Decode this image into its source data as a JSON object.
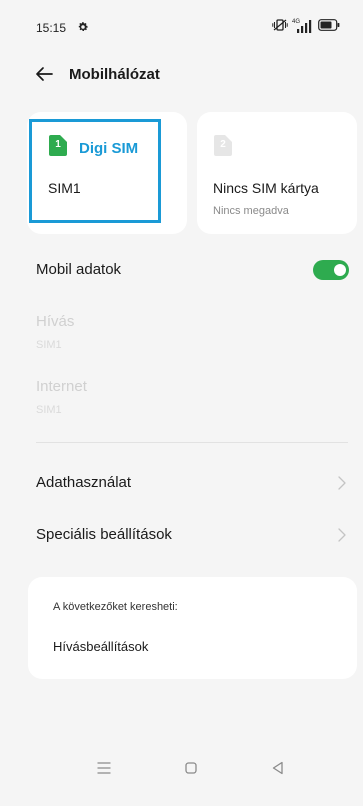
{
  "status_bar": {
    "time": "15:15",
    "icons": [
      "gear-icon",
      "vibrate-icon",
      "network-4g-icon",
      "signal-icon",
      "battery-icon"
    ],
    "network_label": "4G"
  },
  "header": {
    "title": "Mobilhálózat",
    "back_icon": "arrow-left-icon"
  },
  "sim_cards": [
    {
      "slot_number": "1",
      "carrier": "Digi SIM",
      "label": "SIM1",
      "icon_color": "#2eab4f",
      "highlighted": true
    },
    {
      "slot_number": "2",
      "title": "Nincs SIM kártya",
      "subtitle": "Nincs megadva",
      "icon_color": "#e6e6e6"
    }
  ],
  "settings": {
    "mobile_data": {
      "label": "Mobil adatok",
      "enabled": true
    },
    "calls": {
      "label": "Hívás",
      "sub": "SIM1",
      "disabled": true
    },
    "internet": {
      "label": "Internet",
      "sub": "SIM1",
      "disabled": true
    },
    "data_usage": {
      "label": "Adathasználat"
    },
    "special_settings": {
      "label": "Speciális beállítások"
    }
  },
  "suggestions": {
    "heading": "A következőket keresheti:",
    "items": [
      "Hívásbeállítások"
    ]
  },
  "colors": {
    "accent": "#1a9ad6",
    "toggle_on": "#2eab4f",
    "background": "#f5f5f5"
  },
  "nav_bar": {
    "icons": [
      "menu-icon",
      "home-icon",
      "back-triangle-icon"
    ]
  }
}
